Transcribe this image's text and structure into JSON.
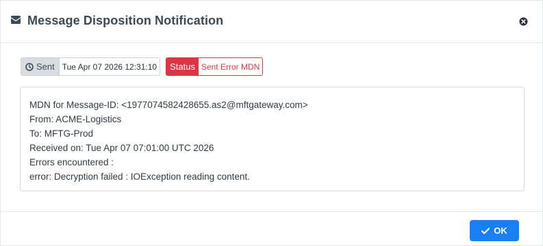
{
  "dialog": {
    "title": "Message Disposition Notification",
    "title_icon": "envelope-icon",
    "close_icon": "close-circle-icon"
  },
  "meta": {
    "sent_icon": "clock-icon",
    "sent_label": "Sent",
    "sent_value": "Tue Apr 07 2026 12:31:10",
    "status_label": "Status",
    "status_value": "Sent Error MDN",
    "status_color": "#dc3545"
  },
  "mdn": {
    "lines": [
      "MDN for Message-ID: <1977074582428655.as2@mftgateway.com>",
      "From: ACME-Logistics",
      "To: MFTG-Prod",
      "Received on: Tue Apr 07 07:01:00 UTC 2026",
      "Errors encountered :",
      "error: Decryption failed : IOException reading content."
    ]
  },
  "footer": {
    "ok_label": "OK",
    "ok_icon": "check-icon",
    "ok_color": "#1a7ff3"
  }
}
